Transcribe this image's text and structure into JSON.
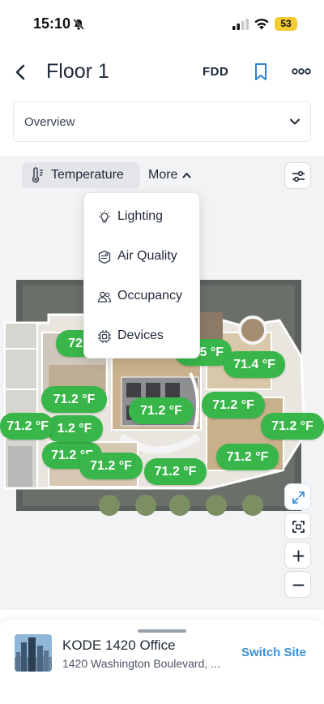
{
  "status_bar": {
    "time": "15:10",
    "battery": "53"
  },
  "header": {
    "title": "Floor 1",
    "fdd_label": "FDD"
  },
  "view_select": {
    "value": "Overview"
  },
  "metric_tabs": {
    "active": "Temperature",
    "more": "More"
  },
  "more_menu": {
    "items": [
      {
        "label": "Lighting",
        "icon": "lightbulb-icon"
      },
      {
        "label": "Air Quality",
        "icon": "air-quality-icon"
      },
      {
        "label": "Occupancy",
        "icon": "occupancy-icon"
      },
      {
        "label": "Devices",
        "icon": "devices-icon"
      }
    ]
  },
  "temperatures": {
    "t1": "72",
    "t2": "5 °F",
    "t3": "71.4 °F",
    "t4": "71.2 °F",
    "t5": "71.2 °F",
    "t6": "71.2 °F",
    "t7": "71.2 °F",
    "t8": "1.2 °F",
    "t9": "71.2 °F",
    "t10": "71.2 °F",
    "t11": "71.2 °F",
    "t12": "71.2 °F",
    "t13": "71.2 °F"
  },
  "site": {
    "name": "KODE 1420 Office",
    "address": "1420 Washington Boulevard, ...",
    "switch_label": "Switch Site"
  },
  "colors": {
    "accent": "#3a8fd6",
    "temp_pill": "#38b64a",
    "battery": "#f4cc31"
  }
}
